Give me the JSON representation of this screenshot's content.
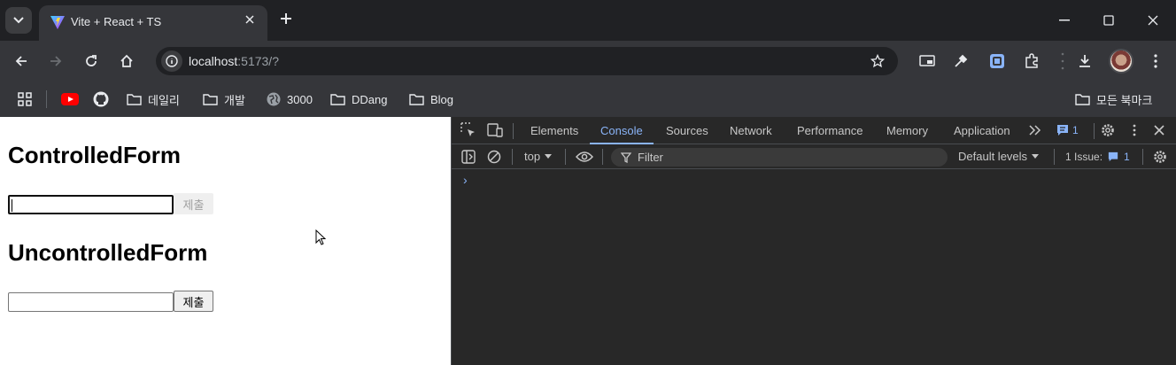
{
  "browser": {
    "tab_title": "Vite + React + TS",
    "url_host": "localhost",
    "url_rest": ":5173/?",
    "colors": {
      "frame": "#202124",
      "toolbar": "#35363a",
      "accent": "#8ab4f8"
    }
  },
  "bookmarks": {
    "items": [
      {
        "label": "",
        "icon": "youtube-icon"
      },
      {
        "label": "",
        "icon": "github-icon"
      },
      {
        "label": "데일리",
        "icon": "folder-icon"
      },
      {
        "label": "개발",
        "icon": "folder-icon"
      },
      {
        "label": "3000",
        "icon": "globe-icon"
      },
      {
        "label": "DDang",
        "icon": "folder-icon"
      },
      {
        "label": "Blog",
        "icon": "folder-icon"
      }
    ],
    "all_bookmarks": "모든 북마크"
  },
  "page": {
    "controlled_heading": "ControlledForm",
    "controlled_submit": "제출",
    "uncontrolled_heading": "UncontrolledForm",
    "uncontrolled_submit": "제출"
  },
  "devtools": {
    "tabs": [
      "Elements",
      "Console",
      "Sources",
      "Network",
      "Performance",
      "Memory",
      "Application"
    ],
    "active_tab": "Console",
    "issues_badge": "1",
    "context": "top",
    "filter_placeholder": "Filter",
    "levels": "Default levels",
    "issues_label": "1 Issue:",
    "issues_count": "1",
    "prompt": "›"
  }
}
